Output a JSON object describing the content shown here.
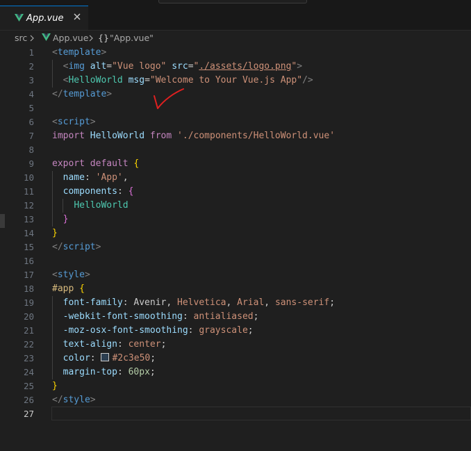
{
  "tabs": [
    {
      "label": "App.vue",
      "icon": "vue-icon",
      "active": true
    }
  ],
  "breadcrumb": {
    "folder": "src",
    "file": "App.vue",
    "symbol_icon": "{}",
    "symbol": "\"App.vue\""
  },
  "editor": {
    "active_line": 27,
    "lines": [
      {
        "n": "1",
        "tokens": [
          [
            "t-tag",
            "<"
          ],
          [
            "t-tagname",
            "template"
          ],
          [
            "t-tag",
            ">"
          ]
        ]
      },
      {
        "n": "2",
        "tokens": [
          [
            "t-plain",
            "  "
          ],
          [
            "t-tag",
            "<"
          ],
          [
            "t-tagname",
            "img"
          ],
          [
            "t-plain",
            " "
          ],
          [
            "t-attr",
            "alt"
          ],
          [
            "t-plain",
            "="
          ],
          [
            "t-str",
            "\"Vue logo\""
          ],
          [
            "t-plain",
            " "
          ],
          [
            "t-attr",
            "src"
          ],
          [
            "t-plain",
            "="
          ],
          [
            "t-str",
            "\""
          ],
          [
            "t-str t-link",
            "./assets/logo.png"
          ],
          [
            "t-str",
            "\""
          ],
          [
            "t-tag",
            ">"
          ]
        ]
      },
      {
        "n": "3",
        "tokens": [
          [
            "t-plain",
            "  "
          ],
          [
            "t-tag",
            "<"
          ],
          [
            "t-comp",
            "HelloWorld"
          ],
          [
            "t-plain",
            " "
          ],
          [
            "t-attr",
            "msg"
          ],
          [
            "t-plain",
            "="
          ],
          [
            "t-str",
            "\"Welcome to Your Vue.js App\""
          ],
          [
            "t-tag",
            "/>"
          ]
        ]
      },
      {
        "n": "4",
        "tokens": [
          [
            "t-tag",
            "</"
          ],
          [
            "t-tagname",
            "template"
          ],
          [
            "t-tag",
            ">"
          ]
        ]
      },
      {
        "n": "5",
        "tokens": []
      },
      {
        "n": "6",
        "tokens": [
          [
            "t-tag",
            "<"
          ],
          [
            "t-tagname",
            "script"
          ],
          [
            "t-tag",
            ">"
          ]
        ]
      },
      {
        "n": "7",
        "tokens": [
          [
            "t-kw",
            "import"
          ],
          [
            "t-plain",
            " "
          ],
          [
            "t-id",
            "HelloWorld"
          ],
          [
            "t-plain",
            " "
          ],
          [
            "t-kw",
            "from"
          ],
          [
            "t-plain",
            " "
          ],
          [
            "t-str",
            "'./components/HelloWorld.vue'"
          ]
        ]
      },
      {
        "n": "8",
        "tokens": []
      },
      {
        "n": "9",
        "tokens": [
          [
            "t-kw",
            "export"
          ],
          [
            "t-plain",
            " "
          ],
          [
            "t-kw",
            "default"
          ],
          [
            "t-plain",
            " "
          ],
          [
            "t-brace1",
            "{"
          ]
        ]
      },
      {
        "n": "10",
        "tokens": [
          [
            "t-plain",
            "  "
          ],
          [
            "t-id",
            "name"
          ],
          [
            "t-plain",
            ": "
          ],
          [
            "t-str",
            "'App'"
          ],
          [
            "t-plain",
            ","
          ]
        ]
      },
      {
        "n": "11",
        "tokens": [
          [
            "t-plain",
            "  "
          ],
          [
            "t-id",
            "components"
          ],
          [
            "t-plain",
            ": "
          ],
          [
            "t-brace2",
            "{"
          ]
        ]
      },
      {
        "n": "12",
        "tokens": [
          [
            "t-plain",
            "    "
          ],
          [
            "t-comp",
            "HelloWorld"
          ]
        ]
      },
      {
        "n": "13",
        "tokens": [
          [
            "t-plain",
            "  "
          ],
          [
            "t-brace2",
            "}"
          ]
        ]
      },
      {
        "n": "14",
        "tokens": [
          [
            "t-brace1",
            "}"
          ]
        ]
      },
      {
        "n": "15",
        "tokens": [
          [
            "t-tag",
            "</"
          ],
          [
            "t-tagname",
            "script"
          ],
          [
            "t-tag",
            ">"
          ]
        ]
      },
      {
        "n": "16",
        "tokens": []
      },
      {
        "n": "17",
        "tokens": [
          [
            "t-tag",
            "<"
          ],
          [
            "t-tagname",
            "style"
          ],
          [
            "t-tag",
            ">"
          ]
        ]
      },
      {
        "n": "18",
        "tokens": [
          [
            "t-sel",
            "#app"
          ],
          [
            "t-plain",
            " "
          ],
          [
            "t-brace1",
            "{"
          ]
        ]
      },
      {
        "n": "19",
        "tokens": [
          [
            "t-plain",
            "  "
          ],
          [
            "t-id",
            "font-family"
          ],
          [
            "t-plain",
            ": Avenir, "
          ],
          [
            "t-str",
            "Helvetica"
          ],
          [
            "t-plain",
            ", "
          ],
          [
            "t-str",
            "Arial"
          ],
          [
            "t-plain",
            ", "
          ],
          [
            "t-str",
            "sans-serif"
          ],
          [
            "t-plain",
            ";"
          ]
        ]
      },
      {
        "n": "20",
        "tokens": [
          [
            "t-plain",
            "  "
          ],
          [
            "t-id",
            "-webkit-font-smoothing"
          ],
          [
            "t-plain",
            ": "
          ],
          [
            "t-str",
            "antialiased"
          ],
          [
            "t-plain",
            ";"
          ]
        ]
      },
      {
        "n": "21",
        "tokens": [
          [
            "t-plain",
            "  "
          ],
          [
            "t-id",
            "-moz-osx-font-smoothing"
          ],
          [
            "t-plain",
            ": "
          ],
          [
            "t-str",
            "grayscale"
          ],
          [
            "t-plain",
            ";"
          ]
        ]
      },
      {
        "n": "22",
        "tokens": [
          [
            "t-plain",
            "  "
          ],
          [
            "t-id",
            "text-align"
          ],
          [
            "t-plain",
            ": "
          ],
          [
            "t-str",
            "center"
          ],
          [
            "t-plain",
            ";"
          ]
        ]
      },
      {
        "n": "23",
        "tokens": [
          [
            "t-plain",
            "  "
          ],
          [
            "t-id",
            "color"
          ],
          [
            "t-plain",
            ": "
          ],
          [
            "swatch",
            ""
          ],
          [
            "t-str",
            "#2c3e50"
          ],
          [
            "t-plain",
            ";"
          ]
        ]
      },
      {
        "n": "24",
        "tokens": [
          [
            "t-plain",
            "  "
          ],
          [
            "t-id",
            "margin-top"
          ],
          [
            "t-plain",
            ": "
          ],
          [
            "t-num",
            "60px"
          ],
          [
            "t-plain",
            ";"
          ]
        ]
      },
      {
        "n": "25",
        "tokens": [
          [
            "t-brace1",
            "}"
          ]
        ]
      },
      {
        "n": "26",
        "tokens": [
          [
            "t-tag",
            "</"
          ],
          [
            "t-tagname",
            "style"
          ],
          [
            "t-tag",
            ">"
          ]
        ]
      },
      {
        "n": "27",
        "tokens": []
      }
    ]
  },
  "colors": {
    "background": "#1f1f1f",
    "tab_accent": "#0078d4",
    "vue_green": "#41b883",
    "annotation": "#e02020"
  },
  "icons": {
    "tab_close": "close-icon",
    "breadcrumb_separator": "chevron-right-icon",
    "file_icon": "vue-icon"
  }
}
